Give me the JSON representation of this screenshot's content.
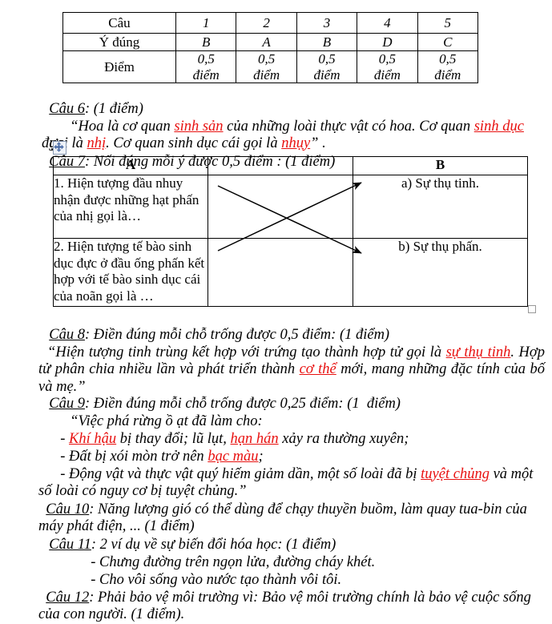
{
  "answer_table": {
    "rows": [
      {
        "label": "Câu",
        "values": [
          "1",
          "2",
          "3",
          "4",
          "5"
        ]
      },
      {
        "label": "Ý đúng",
        "values": [
          "B",
          "A",
          "B",
          "D",
          "C"
        ]
      },
      {
        "label": "Điểm",
        "values": [
          "0,5 điểm",
          "0,5 điểm",
          "0,5 điểm",
          "0,5 điểm",
          "0,5 điểm"
        ]
      }
    ],
    "score_value": "0,5",
    "score_unit": "điểm"
  },
  "cau6": {
    "heading": "Câu 6",
    "heading_rest": ": (1 điểm)",
    "line1_a": "“Hoa là cơ quan ",
    "ans1": "sinh sản",
    "line1_b": " của những loài thực vật có hoa. Cơ quan ",
    "ans2": "sinh dục",
    "line1_c": " đực",
    "line2_a": "gọi là ",
    "ans3": "nhị",
    "line2_b": ". Cơ quan sinh dục cái gọi là ",
    "ans4": "nhụy",
    "line2_c": "” ."
  },
  "cau7": {
    "heading": "Câu 7",
    "heading_rest": ": Nối đúng mỗi ý được 0,5 điểm : (1 điểm)",
    "col_a_header": "A",
    "col_b_header": "B",
    "items_a": [
      "1. Hiện tượng đầu nhuy nhận được những hạt phấn của nhị gọi là…",
      "2. Hiện tượng tế bào sinh dục đực ở đầu ống phấn kết hợp với tế bào sinh dục cái của noãn gọi là …"
    ],
    "items_b": [
      "a) Sự thụ tinh.",
      "b) Sự thụ phấn."
    ]
  },
  "cau8": {
    "heading": "Câu 8",
    "heading_rest": ": Điền đúng mỗi chỗ trống được 0,5 điểm: (1 điểm)",
    "body_a": "“Hiện tượng tinh trùng kết hợp với trứng tạo thành hợp tử gọi là ",
    "ans1": "sự thụ tinh",
    "body_b": ". Hợp tử phân chia nhiều lần và phát triển thành ",
    "ans2": "cơ thể",
    "body_c": " mới, mang những đặc tính của bố và mẹ.”"
  },
  "cau9": {
    "heading": "Câu 9",
    "heading_rest": ": Điền đúng mỗi chỗ trống được 0,25 điểm: (1  điểm)",
    "intro": "“Việc phá rừng ồ ạt đã làm cho:",
    "b1_a": "- ",
    "b1_ans": "Khí hậu",
    "b1_b": " bị thay đổi; lũ lụt, ",
    "b1_ans2": "hạn hán",
    "b1_c": " xảy ra thường xuyên;",
    "b2_a": "- Đất bị xói mòn trở nên ",
    "b2_ans": "bạc màu",
    "b2_b": ";",
    "b3_a": "- Động vật và thực vật quý hiếm giảm dần, một số loài đã bị ",
    "b3_ans": "tuyệt chủng",
    "b3_b": " và một số loài có nguy cơ bị tuyệt chủng.”"
  },
  "cau10": {
    "heading": "Câu 10",
    "heading_rest": ": Năng lượng gió có thể dùng để chạy thuyền buồm, làm quay tua-bin của máy phát điện, ... (1 điểm)"
  },
  "cau11": {
    "heading": "Câu 11",
    "heading_rest": ": 2 ví dụ về sự biến đổi hóa học: (1 điểm)",
    "example1": "- Chưng đường trên ngọn lửa, đường cháy khét.",
    "example2": "- Cho vôi sống vào nước tạo thành vôi tôi."
  },
  "cau12": {
    "heading": "Câu 12",
    "heading_rest": ": Phải bảo vệ môi trường vì: Bảo vệ môi trường chính là bảo vệ cuộc sống của con người. (1 điểm)."
  },
  "colors": {
    "answer_red": "#e8100f",
    "ink": "#000000"
  }
}
